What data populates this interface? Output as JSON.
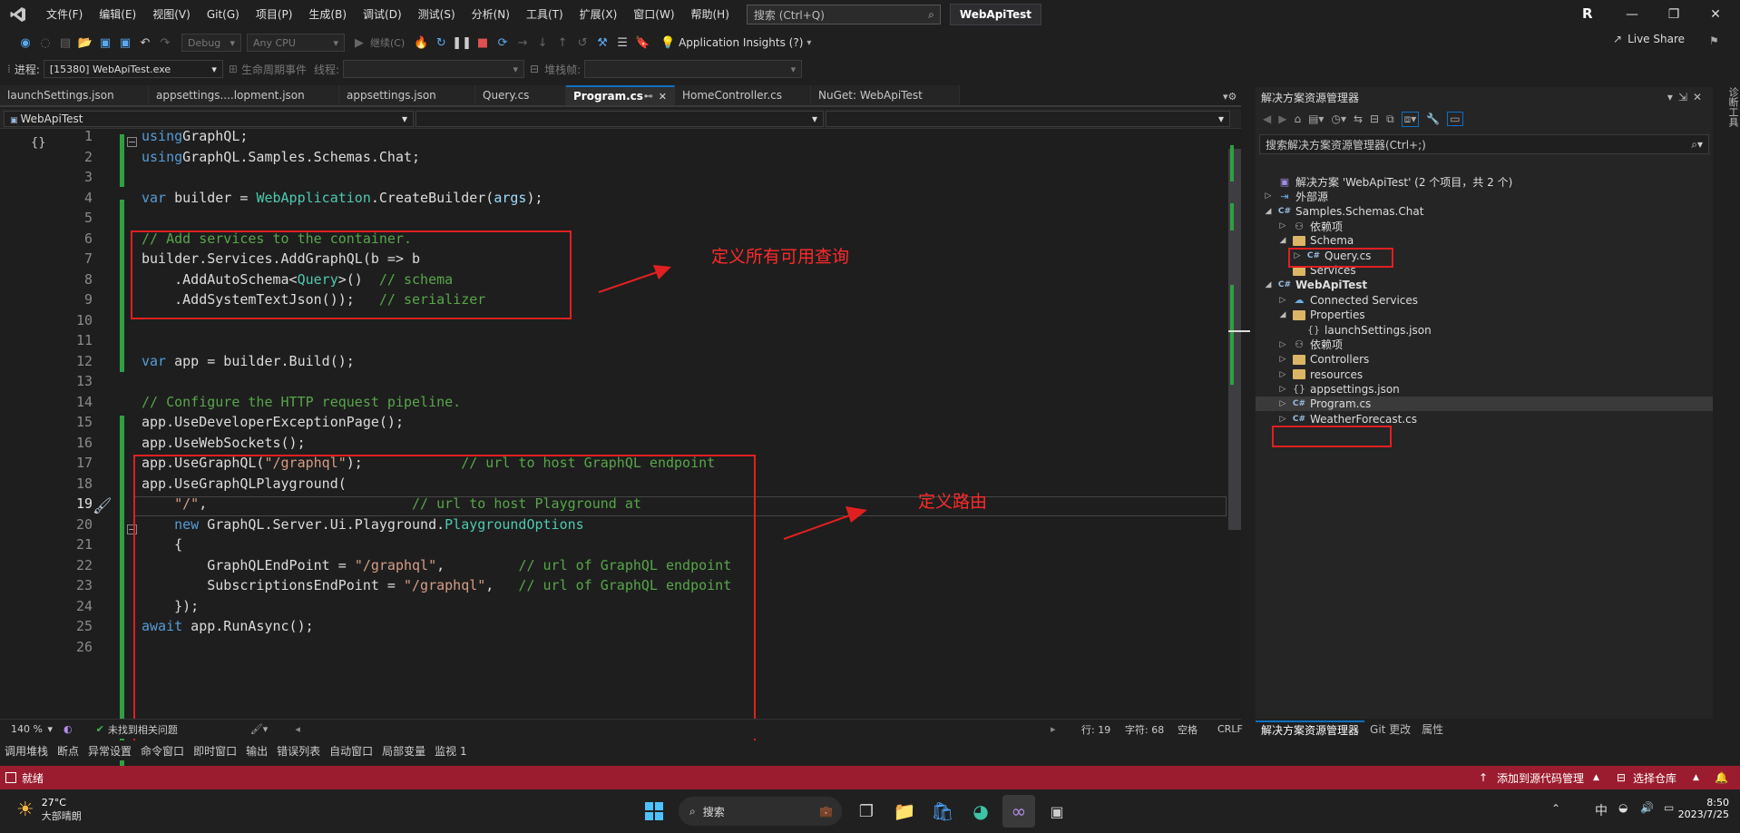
{
  "titlebar": {
    "menu": [
      "文件(F)",
      "编辑(E)",
      "视图(V)",
      "Git(G)",
      "项目(P)",
      "生成(B)",
      "调试(D)",
      "测试(S)",
      "分析(N)",
      "工具(T)",
      "扩展(X)",
      "窗口(W)",
      "帮助(H)"
    ],
    "search_placeholder": "搜索 (Ctrl+Q)",
    "project_name": "WebApiTest",
    "avatar": "R",
    "controls": [
      "—",
      "❐",
      "✕"
    ]
  },
  "toolbar1": {
    "config": "Debug",
    "platform": "Any CPU",
    "continue_label": "继续(C)",
    "insights_label": "Application Insights (?)",
    "live_share": "Live Share"
  },
  "toolbar2": {
    "process_label": "进程:",
    "process_value": "[15380] WebApiTest.exe",
    "lifecycle_label": "生命周期事件",
    "thread_label": "线程:",
    "stackframe_label": "堆栈帧:"
  },
  "tabs": [
    {
      "label": "launchSettings.json",
      "active": false
    },
    {
      "label": "appsettings....lopment.json",
      "active": false
    },
    {
      "label": "appsettings.json",
      "active": false
    },
    {
      "label": "Query.cs",
      "active": false
    },
    {
      "label": "Program.cs",
      "active": true
    },
    {
      "label": "HomeController.cs",
      "active": false
    },
    {
      "label": "NuGet: WebApiTest",
      "active": false
    }
  ],
  "navbar": {
    "scope": "WebApiTest"
  },
  "code_lines": [
    [
      [
        "kw",
        "using"
      ],
      [
        "",
        "GraphQL;"
      ]
    ],
    [
      [
        "kw",
        "using"
      ],
      [
        "",
        "GraphQL.Samples.Schemas.Chat;"
      ]
    ],
    [],
    [
      [
        "kw",
        "var"
      ],
      [
        "",
        " builder = "
      ],
      [
        "ty",
        "WebApplication"
      ],
      [
        "",
        ".CreateBuilder("
      ],
      [
        "pm",
        "args"
      ],
      [
        "",
        ");"
      ]
    ],
    [],
    [
      [
        "cm",
        "// Add services to the container."
      ]
    ],
    [
      [
        "",
        "builder.Services.AddGraphQL(b => b"
      ]
    ],
    [
      [
        "",
        "    .AddAutoSchema<"
      ],
      [
        "ty",
        "Query"
      ],
      [
        "",
        ">()  "
      ],
      [
        "cm",
        "// schema"
      ]
    ],
    [
      [
        "",
        "    .AddSystemTextJson());   "
      ],
      [
        "cm",
        "// serializer"
      ]
    ],
    [],
    [],
    [
      [
        "kw",
        "var"
      ],
      [
        "",
        " app = builder.Build();"
      ]
    ],
    [],
    [
      [
        "cm",
        "// Configure the HTTP request pipeline."
      ]
    ],
    [
      [
        "",
        "app.UseDeveloperExceptionPage();"
      ]
    ],
    [
      [
        "",
        "app.UseWebSockets();"
      ]
    ],
    [
      [
        "",
        "app.UseGraphQL("
      ],
      [
        "st",
        "\"/graphql\""
      ],
      [
        "",
        ");            "
      ],
      [
        "cm",
        "// url to host GraphQL endpoint"
      ]
    ],
    [
      [
        "",
        "app.UseGraphQLPlayground("
      ]
    ],
    [
      [
        "",
        "    "
      ],
      [
        "st",
        "\"/\""
      ],
      [
        "",
        ",                         "
      ],
      [
        "cm",
        "// url to host Playground at"
      ]
    ],
    [
      [
        "",
        "    "
      ],
      [
        "kw",
        "new"
      ],
      [
        "",
        " GraphQL.Server.Ui.Playground."
      ],
      [
        "ty",
        "PlaygroundOptions"
      ]
    ],
    [
      [
        "",
        "    {"
      ]
    ],
    [
      [
        "",
        "        GraphQLEndPoint = "
      ],
      [
        "st",
        "\"/graphql\""
      ],
      [
        "",
        ",         "
      ],
      [
        "cm",
        "// url of GraphQL endpoint"
      ]
    ],
    [
      [
        "",
        "        SubscriptionsEndPoint = "
      ],
      [
        "st",
        "\"/graphql\""
      ],
      [
        "",
        ",   "
      ],
      [
        "cm",
        "// url of GraphQL endpoint"
      ]
    ],
    [
      [
        "",
        "    });"
      ]
    ],
    [
      [
        "kw",
        "await"
      ],
      [
        "",
        " app.RunAsync();"
      ]
    ],
    []
  ],
  "current_line": 19,
  "annotations": {
    "queries": "定义所有可用查询",
    "routing": "定义路由"
  },
  "editor_status": {
    "zoom": "140 %",
    "issues": "未找到相关问题",
    "line": "行: 19",
    "col": "字符: 68",
    "indent": "空格",
    "eol": "CRLF"
  },
  "solution_explorer": {
    "title": "解决方案资源管理器",
    "search_placeholder": "搜索解决方案资源管理器(Ctrl+;)",
    "items": [
      {
        "label": "解决方案 'WebApiTest' (2 个项目，共 2 个)",
        "depth": 0,
        "icon": "solution",
        "arrow": ""
      },
      {
        "label": "外部源",
        "depth": 0,
        "icon": "ext",
        "arrow": "▷"
      },
      {
        "label": "Samples.Schemas.Chat",
        "depth": 0,
        "icon": "csproj",
        "arrow": "◢"
      },
      {
        "label": "依赖项",
        "depth": 1,
        "icon": "deps",
        "arrow": "▷"
      },
      {
        "label": "Schema",
        "depth": 1,
        "icon": "folder",
        "arrow": "◢"
      },
      {
        "label": "Query.cs",
        "depth": 2,
        "icon": "cs",
        "arrow": "▷"
      },
      {
        "label": "Services",
        "depth": 1,
        "icon": "folder",
        "arrow": ""
      },
      {
        "label": "WebApiTest",
        "depth": 0,
        "icon": "csproj",
        "arrow": "◢",
        "bold": true
      },
      {
        "label": "Connected Services",
        "depth": 1,
        "icon": "connected",
        "arrow": "▷"
      },
      {
        "label": "Properties",
        "depth": 1,
        "icon": "folder",
        "arrow": "◢"
      },
      {
        "label": "launchSettings.json",
        "depth": 2,
        "icon": "json",
        "arrow": ""
      },
      {
        "label": "依赖项",
        "depth": 1,
        "icon": "deps",
        "arrow": "▷"
      },
      {
        "label": "Controllers",
        "depth": 1,
        "icon": "folder",
        "arrow": "▷"
      },
      {
        "label": "resources",
        "depth": 1,
        "icon": "folder",
        "arrow": "▷"
      },
      {
        "label": "appsettings.json",
        "depth": 1,
        "icon": "json",
        "arrow": "▷"
      },
      {
        "label": "Program.cs",
        "depth": 1,
        "icon": "cs",
        "arrow": "▷",
        "selected": true
      },
      {
        "label": "WeatherForecast.cs",
        "depth": 1,
        "icon": "cs",
        "arrow": "▷"
      }
    ],
    "bottom_tabs": [
      "解决方案资源管理器",
      "Git 更改",
      "属性"
    ]
  },
  "side_vertical_tab": "诊断工具",
  "bottom_tabs": [
    "调用堆栈",
    "断点",
    "异常设置",
    "命令窗口",
    "即时窗口",
    "输出",
    "错误列表",
    "自动窗口",
    "局部变量",
    "监视 1"
  ],
  "statusbar": {
    "ready": "就绪",
    "add_source": "添加到源代码管理",
    "select_repo": "选择仓库"
  },
  "taskbar": {
    "weather_temp": "27°C",
    "weather_desc": "大部晴朗",
    "search": "搜索",
    "ime": "中",
    "time": "8:50",
    "date": "2023/7/25"
  }
}
